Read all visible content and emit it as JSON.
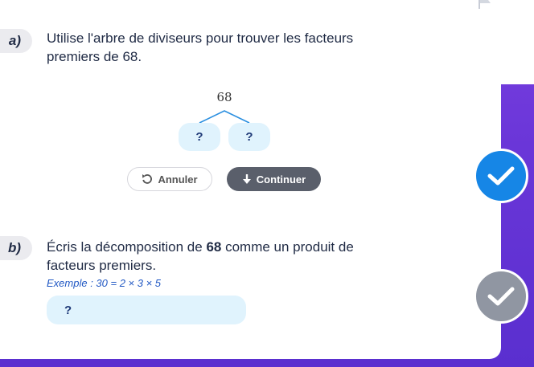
{
  "part_a": {
    "label": "a)",
    "question_line1": "Utilise l'arbre de diviseurs pour trouver les facteurs",
    "question_line2": "premiers de 68.",
    "tree": {
      "root": "68",
      "left_leaf": "?",
      "right_leaf": "?"
    },
    "undo_label": "Annuler",
    "continue_label": "Continuer"
  },
  "part_b": {
    "label": "b)",
    "question_pre": "Écris la décomposition de ",
    "question_bold": "68",
    "question_post": " comme un produit de",
    "question_line2": "facteurs premiers.",
    "example": "Exemple : 30 = 2 × 3 × 5",
    "answer_placeholder": "?"
  },
  "icons": {
    "flag": "flag-icon",
    "undo": "undo-icon",
    "down_arrow": "arrow-down-icon",
    "check_active": "check-icon",
    "check_inactive": "check-icon"
  },
  "colors": {
    "accent_blue": "#1686e6",
    "check_inactive": "#9096a2",
    "continue_button": "#5a5f6b",
    "input_bg": "#e0f3fd",
    "background_purple": "#6a36d8"
  }
}
